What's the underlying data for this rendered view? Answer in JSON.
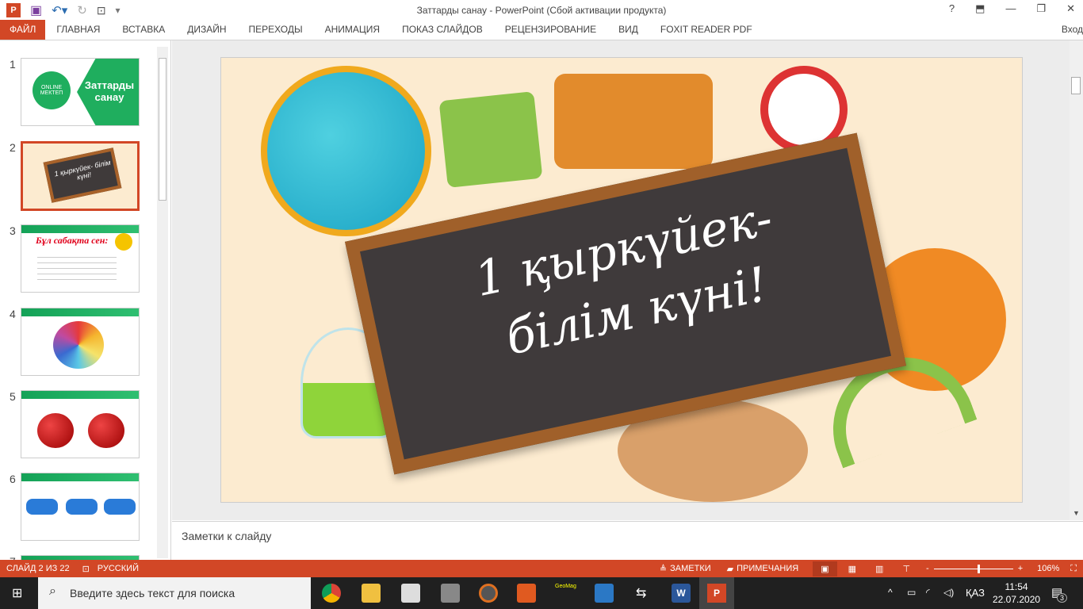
{
  "window": {
    "title": "Заттарды санау - PowerPoint (Сбой активации продукта)",
    "help": "?",
    "login": "Вход"
  },
  "ribbon": {
    "tabs": [
      "ФАЙЛ",
      "ГЛАВНАЯ",
      "ВСТАВКА",
      "ДИЗАЙН",
      "ПЕРЕХОДЫ",
      "АНИМАЦИЯ",
      "ПОКАЗ СЛАЙДОВ",
      "РЕЦЕНЗИРОВАНИЕ",
      "ВИД",
      "FOXIT READER PDF"
    ]
  },
  "slides": [
    {
      "num": "1",
      "logo": "ONLINE МЕКТЕП",
      "title": "Заттарды санау"
    },
    {
      "num": "2",
      "title": "1 қыркүйек- білім күні!"
    },
    {
      "num": "3",
      "title": "Бұл сабақта сен:"
    },
    {
      "num": "4"
    },
    {
      "num": "5"
    },
    {
      "num": "6"
    },
    {
      "num": "7"
    }
  ],
  "current_slide": {
    "line1": "1 қыркүйек-",
    "line2": "білім күні!"
  },
  "notes": {
    "placeholder": "Заметки к слайду"
  },
  "status": {
    "slide": "СЛАЙД 2 ИЗ 22",
    "language": "РУССКИЙ",
    "notes": "ЗАМЕТКИ",
    "comments": "ПРИМЕЧАНИЯ",
    "zoom": "106%",
    "zoom_minus": "-",
    "zoom_plus": "+",
    "zoom_fraction": 0.55
  },
  "taskbar": {
    "search_placeholder": "Введите здесь текст для поиска",
    "language": "ҚАЗ",
    "time": "11:54",
    "date": "22.07.2020",
    "notifications": "3",
    "geomag": "GeoMag"
  }
}
